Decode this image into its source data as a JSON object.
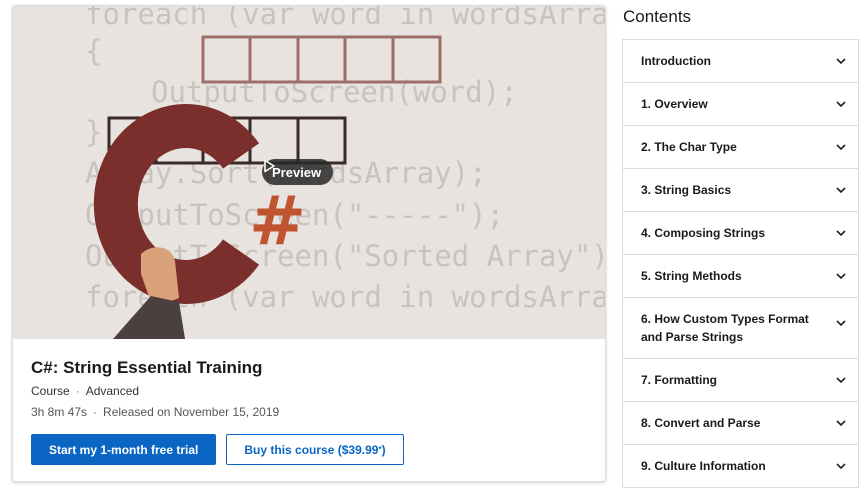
{
  "course": {
    "title": "C#: String Essential Training",
    "type": "Course",
    "level": "Advanced",
    "duration": "3h 8m 47s",
    "released": "Released on November 15, 2019",
    "preview_label": "Preview",
    "trial_button": "Start my 1-month free trial",
    "buy_button_prefix": "Buy this course ($39.99",
    "buy_button_star": "*",
    "buy_button_suffix": ")",
    "hero_code": {
      "line1": "foreach (var word in wordsArray)",
      "line2": "{",
      "line3": "OutputToScreen(word);",
      "line4": "}",
      "line5": "Array.Sort(wordsArray);",
      "line6": "OutputToScreen(\"-----\");",
      "line7": "OutputToScreen(\"Sorted Array\");",
      "line8": "foreach (var word in wordsArray)",
      "logo": "C#"
    }
  },
  "contents": {
    "heading": "Contents",
    "items": [
      "Introduction",
      "1. Overview",
      "2. The Char Type",
      "3. String Basics",
      "4. Composing Strings",
      "5. String Methods",
      "6. How Custom Types Format and Parse Strings",
      "7. Formatting",
      "8. Convert and Parse",
      "9. Culture Information"
    ]
  },
  "colors": {
    "accent": "#0a66c2",
    "logo_c": "#7b2f2d",
    "logo_hash": "#c0542f"
  },
  "icons": {
    "play": "play-icon",
    "chevron": "chevron-down-icon"
  }
}
